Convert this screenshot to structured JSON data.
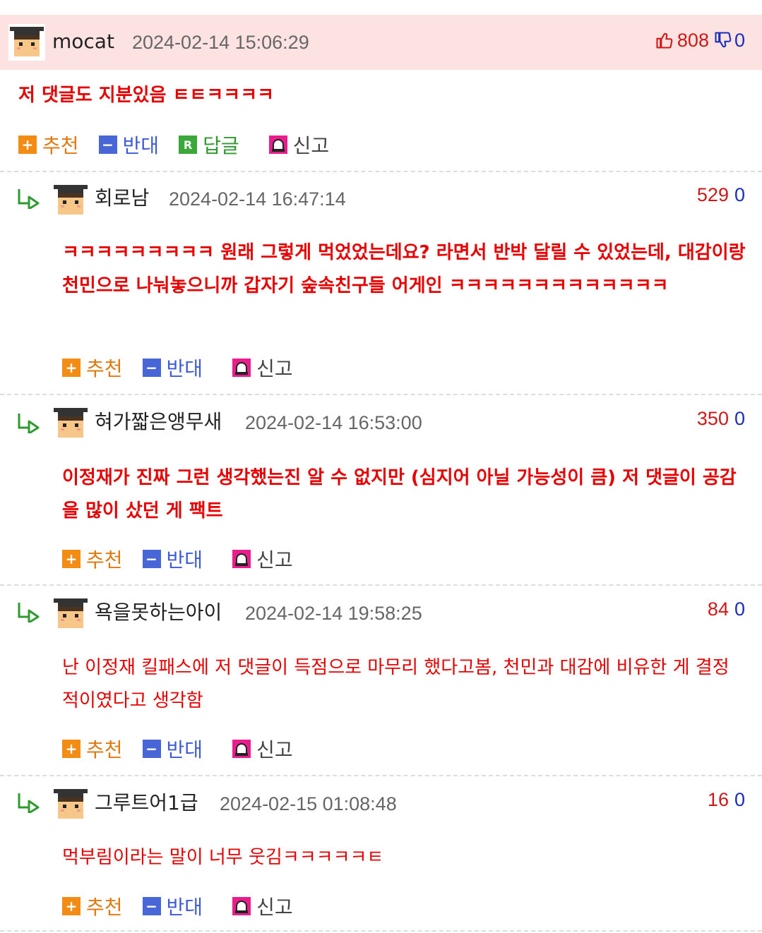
{
  "labels": {
    "recommend": "추천",
    "oppose": "반대",
    "reply": "답글",
    "report": "신고"
  },
  "colors": {
    "highlight_bg": "#fde2e2",
    "comment_text": "#e60000",
    "recommend": "#f28c14",
    "oppose": "#4866d6",
    "reply": "#3aa83a",
    "report": "#e91e8c"
  },
  "comments": [
    {
      "nick": "mocat",
      "date": "2024-02-14 15:06:29",
      "up": "808",
      "down": "0",
      "text": "저 댓글도 지분있음 ㅌㅌㅋㅋㅋㅋ"
    },
    {
      "nick": "회로남",
      "date": "2024-02-14 16:47:14",
      "up": "529",
      "down": "0",
      "text": "ㅋㅋㅋㅋㅋㅋㅋㅋㅋ 원래 그렇게 먹었었는데요? 라면서 반박 달릴 수 있었는데, 대감이랑 천민으로 나눠놓으니까 갑자기 숲속친구들 어게인 ㅋㅋㅋㅋㅋㅋㅋㅋㅋㅋㅋㅋㅋ"
    },
    {
      "nick": "혀가짧은앵무새",
      "date": "2024-02-14 16:53:00",
      "up": "350",
      "down": "0",
      "text": "이정재가 진짜 그런 생각했는진 알 수 없지만 (심지어 아닐 가능성이 큼) 저 댓글이 공감을 많이 샀던 게 팩트"
    },
    {
      "nick": "욕을못하는아이",
      "date": "2024-02-14 19:58:25",
      "up": "84",
      "down": "0",
      "text": "난 이정재 킬패스에 저 댓글이 득점으로 마무리 했다고봄, 천민과 대감에 비유한 게 결정적이였다고 생각함"
    },
    {
      "nick": "그루트어1급",
      "date": "2024-02-15 01:08:48",
      "up": "16",
      "down": "0",
      "text": "먹부림이라는 말이 너무 웃김ㅋㅋㅋㅋㅋㅌ"
    }
  ]
}
